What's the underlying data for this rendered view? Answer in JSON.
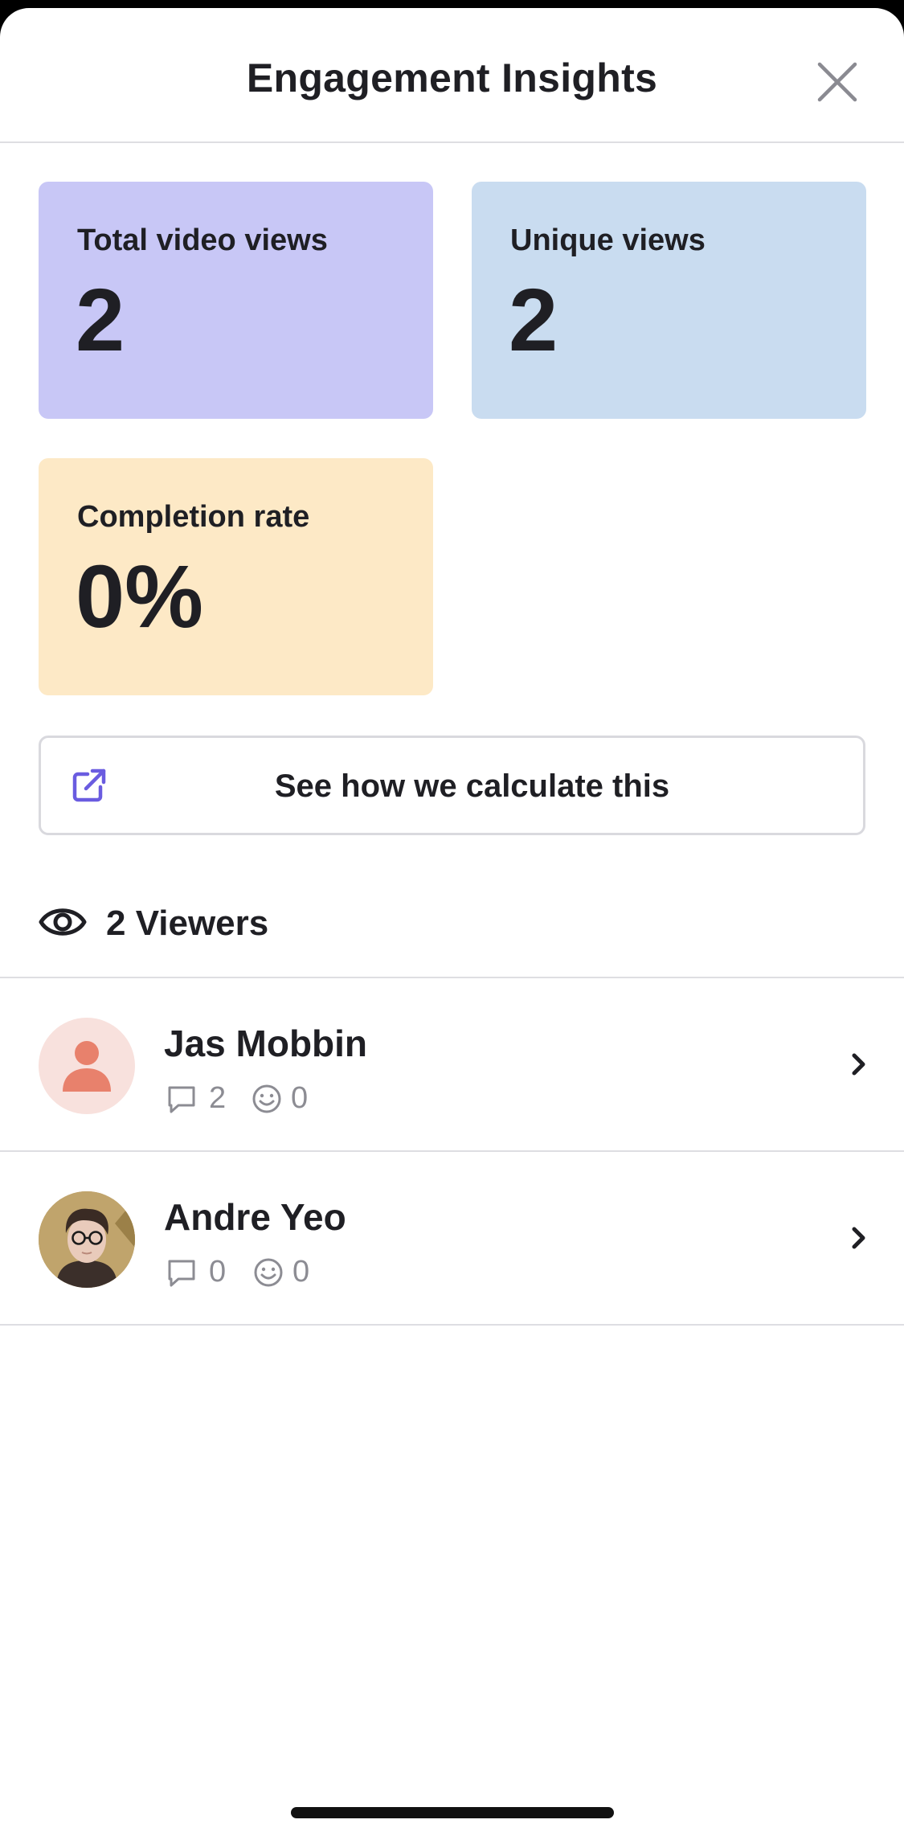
{
  "header": {
    "title": "Engagement Insights"
  },
  "cards": {
    "total_views": {
      "label": "Total video views",
      "value": "2",
      "color": "#c8c7f6"
    },
    "unique_views": {
      "label": "Unique views",
      "value": "2",
      "color": "#c9dcf0"
    },
    "completion_rate": {
      "label": "Completion rate",
      "value": "0%",
      "color": "#fde9c6"
    }
  },
  "calculate_button": {
    "label": "See how we calculate this",
    "icon": "external-link-icon",
    "icon_color": "#6a5ce0"
  },
  "viewers": {
    "heading": "2 Viewers",
    "items": [
      {
        "name": "Jas Mobbin",
        "comments": "2",
        "reactions": "0",
        "avatar": "default-person-avatar"
      },
      {
        "name": "Andre Yeo",
        "comments": "0",
        "reactions": "0",
        "avatar": "photo-avatar"
      }
    ]
  }
}
